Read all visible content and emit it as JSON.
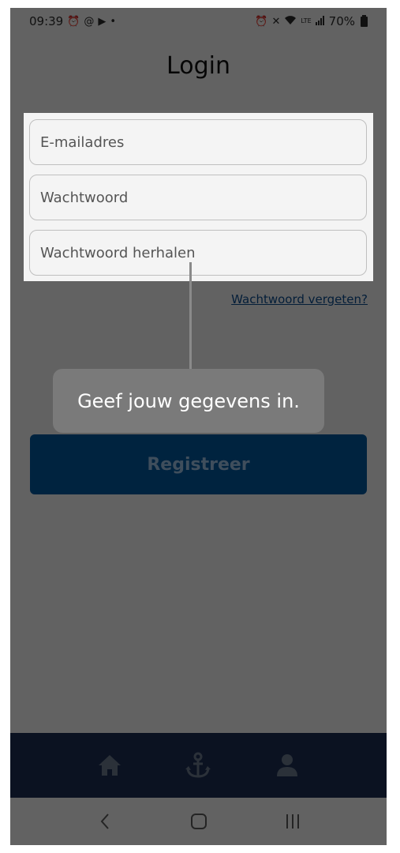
{
  "status_bar": {
    "time": "09:39",
    "left_icons": [
      "alarm-icon",
      "at-icon",
      "play-icon",
      "dot-icon"
    ],
    "right_icons": [
      "alarm-icon",
      "mute-icon",
      "wifi-icon",
      "volte-icon",
      "signal-icon"
    ],
    "battery": "70%"
  },
  "page": {
    "title": "Login"
  },
  "form": {
    "email_placeholder": "E-mailadres",
    "password_placeholder": "Wachtwoord",
    "password_repeat_placeholder": "Wachtwoord herhalen"
  },
  "forgot_link": "Wachtwoord vergeten?",
  "register_button": "Registreer",
  "tooltip": {
    "text": "Geef jouw gegevens in."
  },
  "tabbar": {
    "items": [
      "home-icon",
      "anchor-icon",
      "user-icon"
    ]
  },
  "system_nav": {
    "items": [
      "back-icon",
      "home-circle-icon",
      "recents-icon"
    ]
  },
  "colors": {
    "primary_button": "#00579e",
    "tabbar": "#1c2f53",
    "link": "#0b4c8f",
    "tooltip": "#7a7a7a"
  }
}
